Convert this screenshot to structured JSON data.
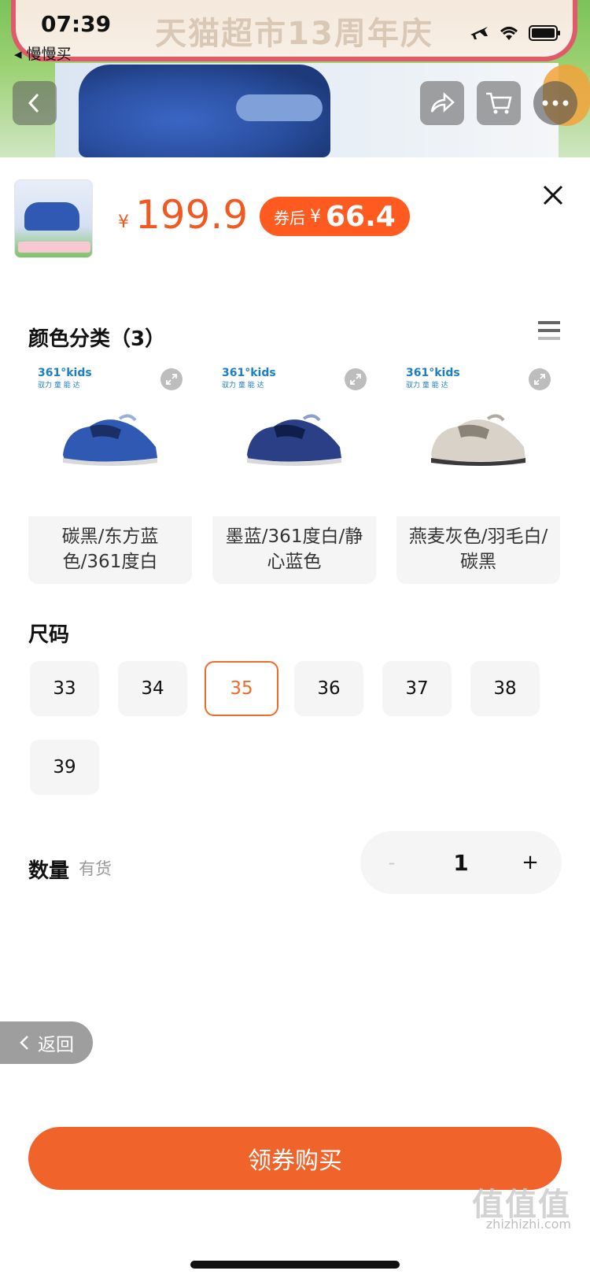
{
  "status_bar": {
    "time": "07:39",
    "back_app": "◂ 慢慢买"
  },
  "background": {
    "banner_title": "天猫超市13周年庆"
  },
  "price": {
    "currency": "¥",
    "amount": "199.9",
    "coupon_label": "券后",
    "coupon_currency": "¥",
    "coupon_amount": "66.4"
  },
  "color_section": {
    "title": "颜色分类（3）",
    "options": [
      {
        "brand": "361°kids",
        "brand_sub": "驭力 童 能 达",
        "label": "碳黑/东方蓝色/361度白",
        "shoe_color": "#2f59b3",
        "accent": "#1a2f66"
      },
      {
        "brand": "361°kids",
        "brand_sub": "驭力 童 能 达",
        "label": "墨蓝/361度白/静心蓝色",
        "shoe_color": "#2a3f86",
        "accent": "#0f1e4a"
      },
      {
        "brand": "361°kids",
        "brand_sub": "驭力 童 能 达",
        "label": "燕麦灰色/羽毛白/碳黑",
        "shoe_color": "#d8d2c8",
        "accent": "#5a5a5a"
      }
    ]
  },
  "size_section": {
    "title": "尺码",
    "sizes": [
      "33",
      "34",
      "35",
      "36",
      "37",
      "38",
      "39"
    ],
    "selected": "35"
  },
  "quantity_section": {
    "title": "数量",
    "stock": "有货",
    "value": "1",
    "minus": "-",
    "plus": "+"
  },
  "return_button": {
    "label": "返回"
  },
  "buy_button": {
    "label": "领券购买"
  },
  "watermark": {
    "text": "值值值",
    "sub": "zhizhizhi.com"
  },
  "colors": {
    "accent": "#f0632a",
    "price": "#f05a22"
  }
}
